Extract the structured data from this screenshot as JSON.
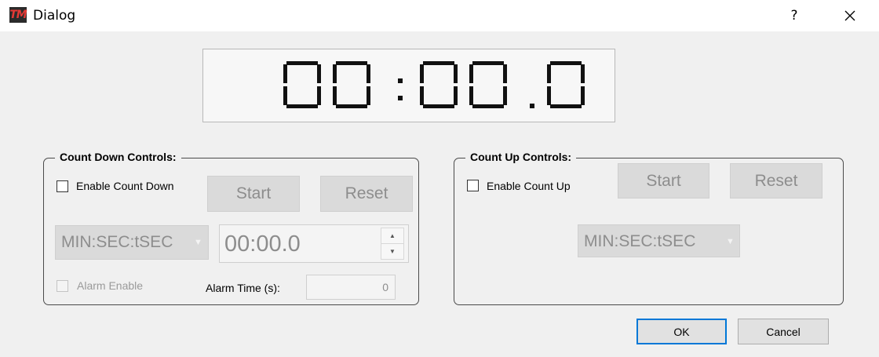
{
  "window": {
    "title": "Dialog",
    "icon_text": "TM",
    "help_label": "?"
  },
  "display": {
    "time": "00:00.0"
  },
  "count_down": {
    "title": "Count Down Controls:",
    "enable_label": "Enable Count Down",
    "start_label": "Start",
    "reset_label": "Reset",
    "format_value": "MIN:SEC:tSEC",
    "time_value": "00:00.0",
    "alarm_enable_label": "Alarm Enable",
    "alarm_time_label": "Alarm Time (s):",
    "alarm_time_value": "0"
  },
  "count_up": {
    "title": "Count Up Controls:",
    "enable_label": "Enable Count Up",
    "start_label": "Start",
    "reset_label": "Reset",
    "format_value": "MIN:SEC:tSEC"
  },
  "buttons": {
    "ok_label": "OK",
    "cancel_label": "Cancel"
  },
  "colors": {
    "accent": "#0078d7",
    "disabled_bg": "#dadada",
    "disabled_text": "#8d8d8d"
  }
}
